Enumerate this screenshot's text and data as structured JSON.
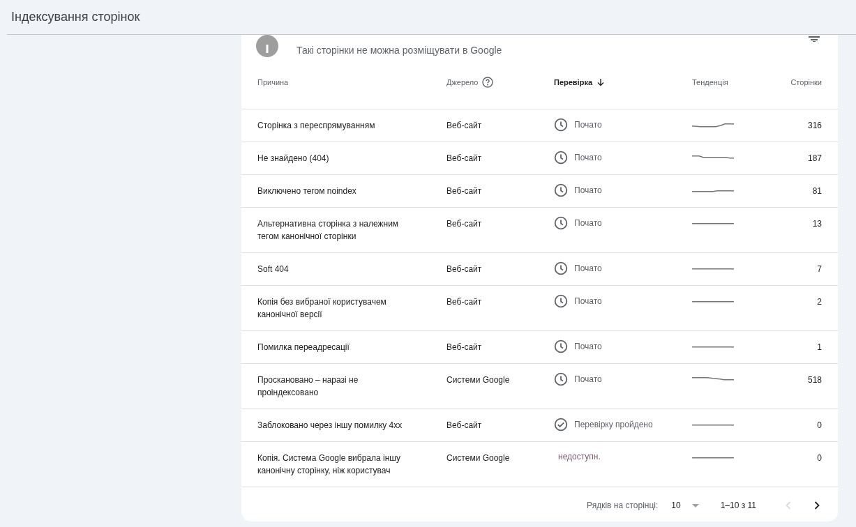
{
  "header": {
    "title": "Індексування сторінок"
  },
  "card": {
    "subtitle": "Такі сторінки не можна розміщувати в Google"
  },
  "table": {
    "columns": [
      {
        "label": "Причина",
        "sorted": false,
        "help": false
      },
      {
        "label": "Джерело",
        "sorted": false,
        "help": true
      },
      {
        "label": "Перевірка",
        "sorted": true,
        "help": false
      },
      {
        "label": "Тенденція",
        "sorted": false,
        "help": false
      },
      {
        "label": "Сторінки",
        "sorted": false,
        "help": false
      }
    ],
    "rows": [
      {
        "reason": "Сторінка з переспрямуванням",
        "source": "Веб-сайт",
        "status": {
          "kind": "started",
          "label": "Почато"
        },
        "pages": "316"
      },
      {
        "reason": "Не знайдено (404)",
        "source": "Веб-сайт",
        "status": {
          "kind": "started",
          "label": "Почато"
        },
        "pages": "187"
      },
      {
        "reason": "Виключено тегом noindex",
        "source": "Веб-сайт",
        "status": {
          "kind": "started",
          "label": "Почато"
        },
        "pages": "81"
      },
      {
        "reason": "Альтернативна сторінка з належним тегом канонічної сторінки",
        "source": "Веб-сайт",
        "status": {
          "kind": "started",
          "label": "Почато"
        },
        "pages": "13"
      },
      {
        "reason": "Soft 404",
        "source": "Веб-сайт",
        "status": {
          "kind": "started",
          "label": "Почато"
        },
        "pages": "7"
      },
      {
        "reason": "Копія без вибраної користувачем канонічної версії",
        "source": "Веб-сайт",
        "status": {
          "kind": "started",
          "label": "Почато"
        },
        "pages": "2"
      },
      {
        "reason": "Помилка переадресації",
        "source": "Веб-сайт",
        "status": {
          "kind": "started",
          "label": "Почато"
        },
        "pages": "1"
      },
      {
        "reason": "Проскановано – наразі не проіндексовано",
        "source": "Системи Google",
        "status": {
          "kind": "started",
          "label": "Почато"
        },
        "pages": "518"
      },
      {
        "reason": "Заблоковано через іншу помилку 4xx",
        "source": "Веб-сайт",
        "status": {
          "kind": "passed",
          "label": "Перевірку пройдено"
        },
        "pages": "0"
      },
      {
        "reason": "Копія. Система Google вибрала іншу канонічну сторінку, ніж користувач",
        "source": "Системи Google",
        "status": {
          "kind": "unavailable",
          "label": "недоступн."
        },
        "pages": "0"
      }
    ]
  },
  "pagination": {
    "rows_label": "Рядків на сторінці:",
    "rows_value": "10",
    "range": "1–10 з 11",
    "prev_disabled": true,
    "next_disabled": false
  }
}
